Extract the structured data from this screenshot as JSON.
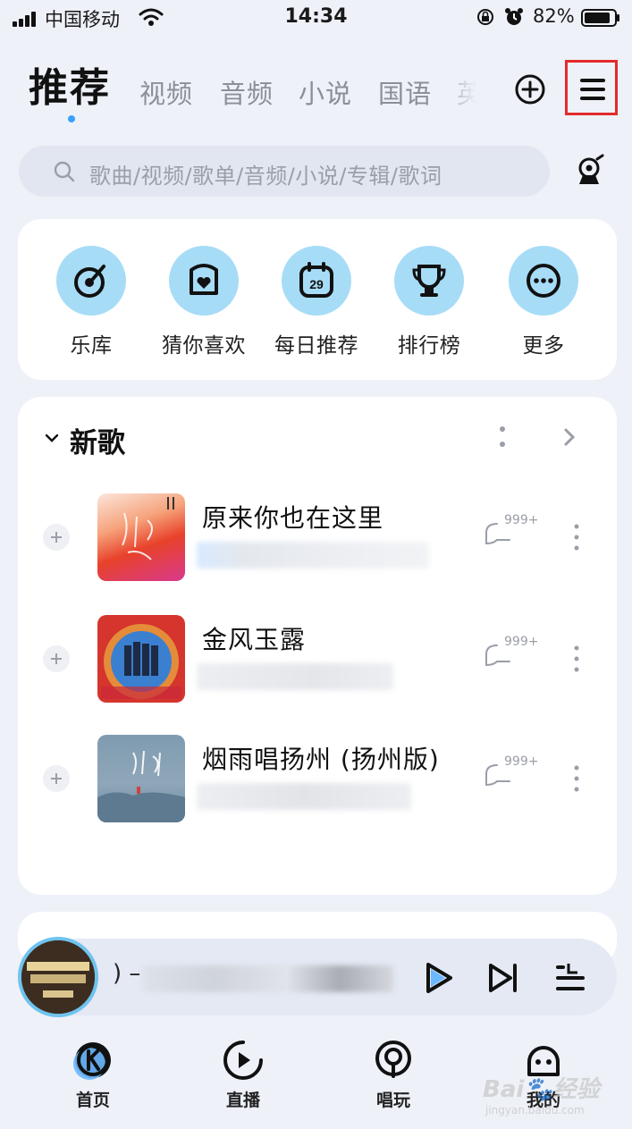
{
  "status_bar": {
    "carrier": "中国移动",
    "time": "14:34",
    "battery": "82%",
    "icons": [
      "signal-icon",
      "wifi-icon",
      "rotation-lock-icon",
      "alarm-icon",
      "battery-icon"
    ]
  },
  "tabs": {
    "active": "推荐",
    "items": [
      "视频",
      "音频",
      "小说",
      "国语",
      "英"
    ]
  },
  "search": {
    "placeholder": "歌曲/视频/歌单/音频/小说/专辑/歌词"
  },
  "quick_actions": [
    {
      "label": "乐库",
      "icon": "music-library-icon"
    },
    {
      "label": "猜你喜欢",
      "icon": "heart-icon"
    },
    {
      "label": "每日推荐",
      "icon": "calendar-icon",
      "badge": "29"
    },
    {
      "label": "排行榜",
      "icon": "trophy-icon"
    },
    {
      "label": "更多",
      "icon": "more-icon"
    }
  ],
  "new_songs": {
    "title": "新歌",
    "items": [
      {
        "title": "原来你也在这里",
        "comments": "999+"
      },
      {
        "title": "金风玉露",
        "comments": "999+"
      },
      {
        "title": "烟雨唱扬州 (扬州版)",
        "comments": "999+"
      }
    ]
  },
  "player": {
    "now_playing": ") – "
  },
  "bottom_nav": [
    {
      "label": "首页",
      "icon": "home-k-icon"
    },
    {
      "label": "直播",
      "icon": "live-icon"
    },
    {
      "label": "唱玩",
      "icon": "sing-icon"
    },
    {
      "label": "我的",
      "icon": "profile-icon"
    }
  ],
  "watermark": {
    "text": "Bai🐾经验",
    "sub": "jingyan.baidu.com"
  },
  "colors": {
    "accent": "#3aa0ff",
    "icon_bg": "#a7dcf7",
    "highlight_box": "#e22b2b"
  }
}
